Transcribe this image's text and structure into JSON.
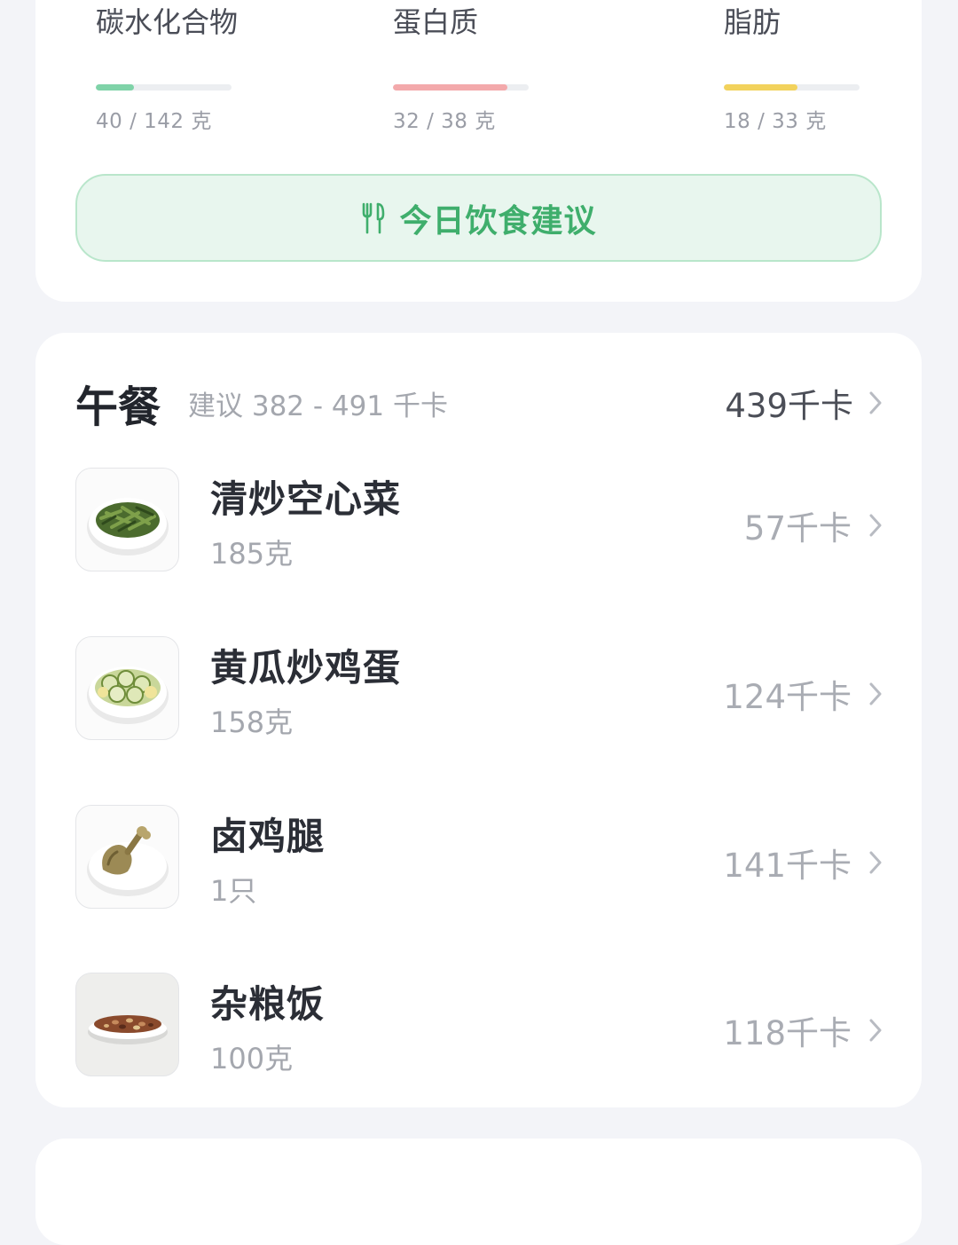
{
  "macros": [
    {
      "name": "碳水化合物",
      "amount": "40 / 142 克",
      "consumed": 40,
      "target": 142,
      "color": "#7fd3a8"
    },
    {
      "name": "蛋白质",
      "amount": "32 / 38 克",
      "consumed": 32,
      "target": 38,
      "color": "#f3a9ab"
    },
    {
      "name": "脂肪",
      "amount": "18 / 33 克",
      "consumed": 18,
      "target": 33,
      "color": "#f2d25c"
    }
  ],
  "advice": {
    "label": "今日饮食建议",
    "icon": "fork-knife-icon",
    "color": "#3fae6c"
  },
  "lunch": {
    "title": "午餐",
    "suggestion": "建议 382 - 491 千卡",
    "total": "439千卡",
    "items": [
      {
        "name": "清炒空心菜",
        "amount": "185克",
        "calories": "57千卡",
        "image": "stir-fried-water-spinach"
      },
      {
        "name": "黄瓜炒鸡蛋",
        "amount": "158克",
        "calories": "124千卡",
        "image": "cucumber-scrambled-egg"
      },
      {
        "name": "卤鸡腿",
        "amount": "1只",
        "calories": "141千卡",
        "image": "braised-chicken-leg"
      },
      {
        "name": "杂粮饭",
        "amount": "100克",
        "calories": "118千卡",
        "image": "multigrain-rice"
      }
    ]
  }
}
